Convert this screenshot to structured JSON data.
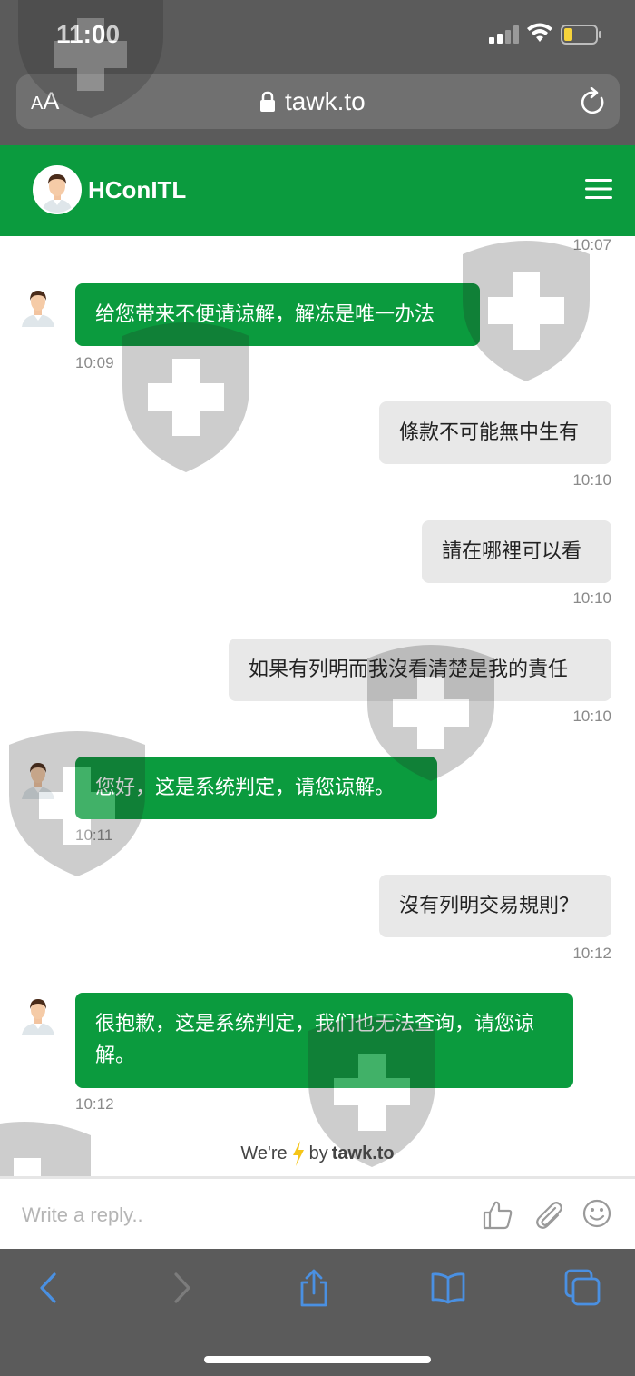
{
  "status_bar": {
    "time": "11:00"
  },
  "browser": {
    "aa_small": "A",
    "aa_big": "A",
    "url": "tawk.to"
  },
  "chat": {
    "agent_name": "HConITL"
  },
  "messages": [
    {
      "time": "10:07"
    },
    {
      "sender": "agent",
      "text": "给您带来不便请谅解，解冻是唯一办法",
      "time": "10:09"
    },
    {
      "sender": "visitor",
      "text": "條款不可能無中生有",
      "time": "10:10"
    },
    {
      "sender": "visitor",
      "text": "請在哪裡可以看",
      "time": "10:10"
    },
    {
      "sender": "visitor",
      "text": "如果有列明而我沒看清楚是我的責任",
      "time": "10:10"
    },
    {
      "sender": "agent",
      "text": "您好，这是系统判定，请您谅解。",
      "time": "10:11"
    },
    {
      "sender": "visitor",
      "text": "沒有列明交易規則？",
      "time": "10:12"
    },
    {
      "sender": "agent",
      "text": "很抱歉，这是系统判定，我们也无法查询，请您谅解。",
      "time": "10:12"
    }
  ],
  "branding": {
    "prefix": "We're",
    "middle": "by",
    "brand": "tawk.to"
  },
  "reply": {
    "placeholder": "Write a reply.."
  },
  "colors": {
    "accent": "#0b9b3e",
    "visitor_bubble": "#e8e8e8",
    "ios_bar": "#5b5b5b",
    "safari_blue": "#4a90e2"
  },
  "icons": [
    "lock-icon",
    "reload-icon",
    "menu-icon",
    "like-icon",
    "paperclip-icon",
    "emoji-icon",
    "back-icon",
    "forward-icon",
    "share-icon",
    "bookmarks-icon",
    "tabs-icon"
  ]
}
